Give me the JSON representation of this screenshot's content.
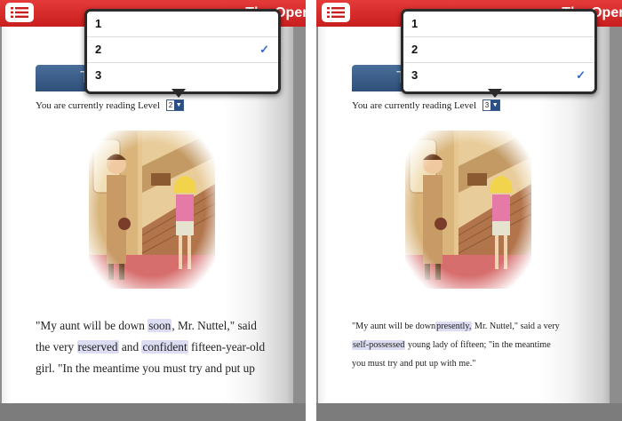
{
  "left": {
    "title_partial": "The Open",
    "tab_label": "T",
    "level_prefix": "You are currently reading Level",
    "selected_level": "2",
    "options": [
      "1",
      "2",
      "3"
    ],
    "checked_index": 1,
    "check_mark": "✓",
    "story_lines": [
      [
        {
          "t": "\"My aunt will be down "
        },
        {
          "t": "soon",
          "hl": true
        },
        {
          "t": ", Mr. Nuttel,\" said"
        }
      ],
      [
        {
          "t": "the very "
        },
        {
          "t": "reserved",
          "hl": true
        },
        {
          "t": " and "
        },
        {
          "t": "confident",
          "hl": true
        },
        {
          "t": " fifteen-year-old"
        }
      ],
      [
        {
          "t": "girl. \"In the meantime you must try and put up"
        }
      ]
    ]
  },
  "right": {
    "title_partial": "The Open",
    "tab_label": "T",
    "level_prefix": "You are currently reading Level",
    "selected_level": "3",
    "options": [
      "1",
      "2",
      "3"
    ],
    "checked_index": 2,
    "check_mark": "✓",
    "story_lines": [
      [
        {
          "t": "\"My aunt will be down"
        },
        {
          "t": "presently,",
          "hl": true
        },
        {
          "t": " Mr. Nuttel,\" said a very"
        }
      ],
      [
        {
          "t": "self-possessed",
          "hl": true
        },
        {
          "t": " young lady of fifteen; \"in the meantime"
        }
      ],
      [
        {
          "t": "you must try and put up with me.\""
        }
      ]
    ]
  },
  "colors": {
    "top_bar": "#d42828",
    "highlight": "#dcdcf2",
    "tab_blue": "#3b5f8a",
    "check": "#3b6bc8"
  },
  "icons": {
    "menu": "list-icon",
    "check": "checkmark-icon",
    "select_arrow": "triangle-down-icon"
  }
}
